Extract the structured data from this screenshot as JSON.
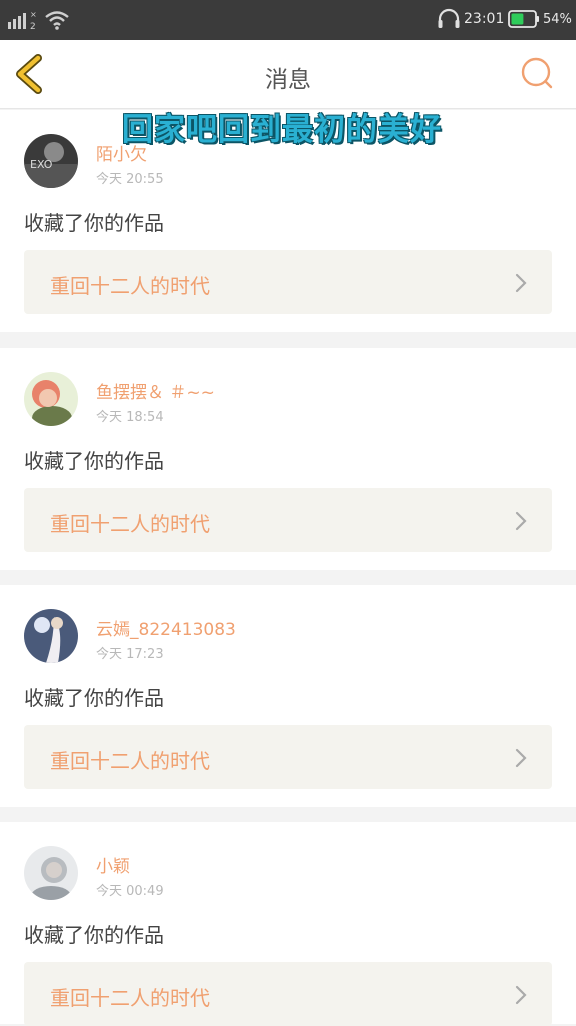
{
  "status_bar": {
    "time": "23:01",
    "battery_percent": "54%",
    "battery_level": 0.54,
    "sim_label": "2"
  },
  "header": {
    "title": "消息",
    "back_icon": "chevron-left-icon",
    "search_icon": "search-icon"
  },
  "overlay_text": "回家吧回到最初的美好",
  "colors": {
    "accent": "#f0a070",
    "back_icon": "#f0c030",
    "overlay_text": "#2ab0d2"
  },
  "notifications": [
    {
      "username": "陌小欠",
      "time": "今天 20:55",
      "action": "收藏了你的作品",
      "work_title": "重回十二人的时代"
    },
    {
      "username": "鱼摆摆＆ ＃~~",
      "time": "今天 18:54",
      "action": "收藏了你的作品",
      "work_title": "重回十二人的时代"
    },
    {
      "username": "云嫣_822413083",
      "time": "今天 17:23",
      "action": "收藏了你的作品",
      "work_title": "重回十二人的时代"
    },
    {
      "username": "小颖",
      "time": "今天 00:49",
      "action": "收藏了你的作品",
      "work_title": "重回十二人的时代"
    }
  ]
}
